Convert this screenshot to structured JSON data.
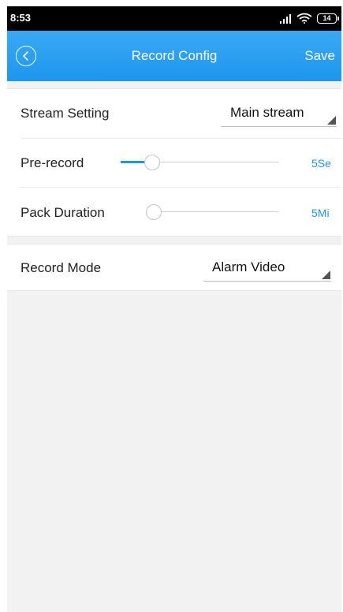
{
  "status_bar": {
    "time": "8:53",
    "battery_level": "14"
  },
  "header": {
    "title": "Record Config",
    "save_label": "Save",
    "back_icon": "back-circle-icon"
  },
  "settings": {
    "stream_setting": {
      "label": "Stream Setting",
      "value": "Main stream"
    },
    "pre_record": {
      "label": "Pre-record",
      "value_text": "5Se",
      "level": 0.15
    },
    "pack_duration": {
      "label": "Pack Duration",
      "value_text": "5Mi",
      "level": 0.0
    },
    "record_mode": {
      "label": "Record Mode",
      "value": "Alarm Video"
    }
  },
  "colors": {
    "accent": "#1e96ee",
    "header_bg": "#2a9df0",
    "page_bg": "#f2f2f2"
  }
}
